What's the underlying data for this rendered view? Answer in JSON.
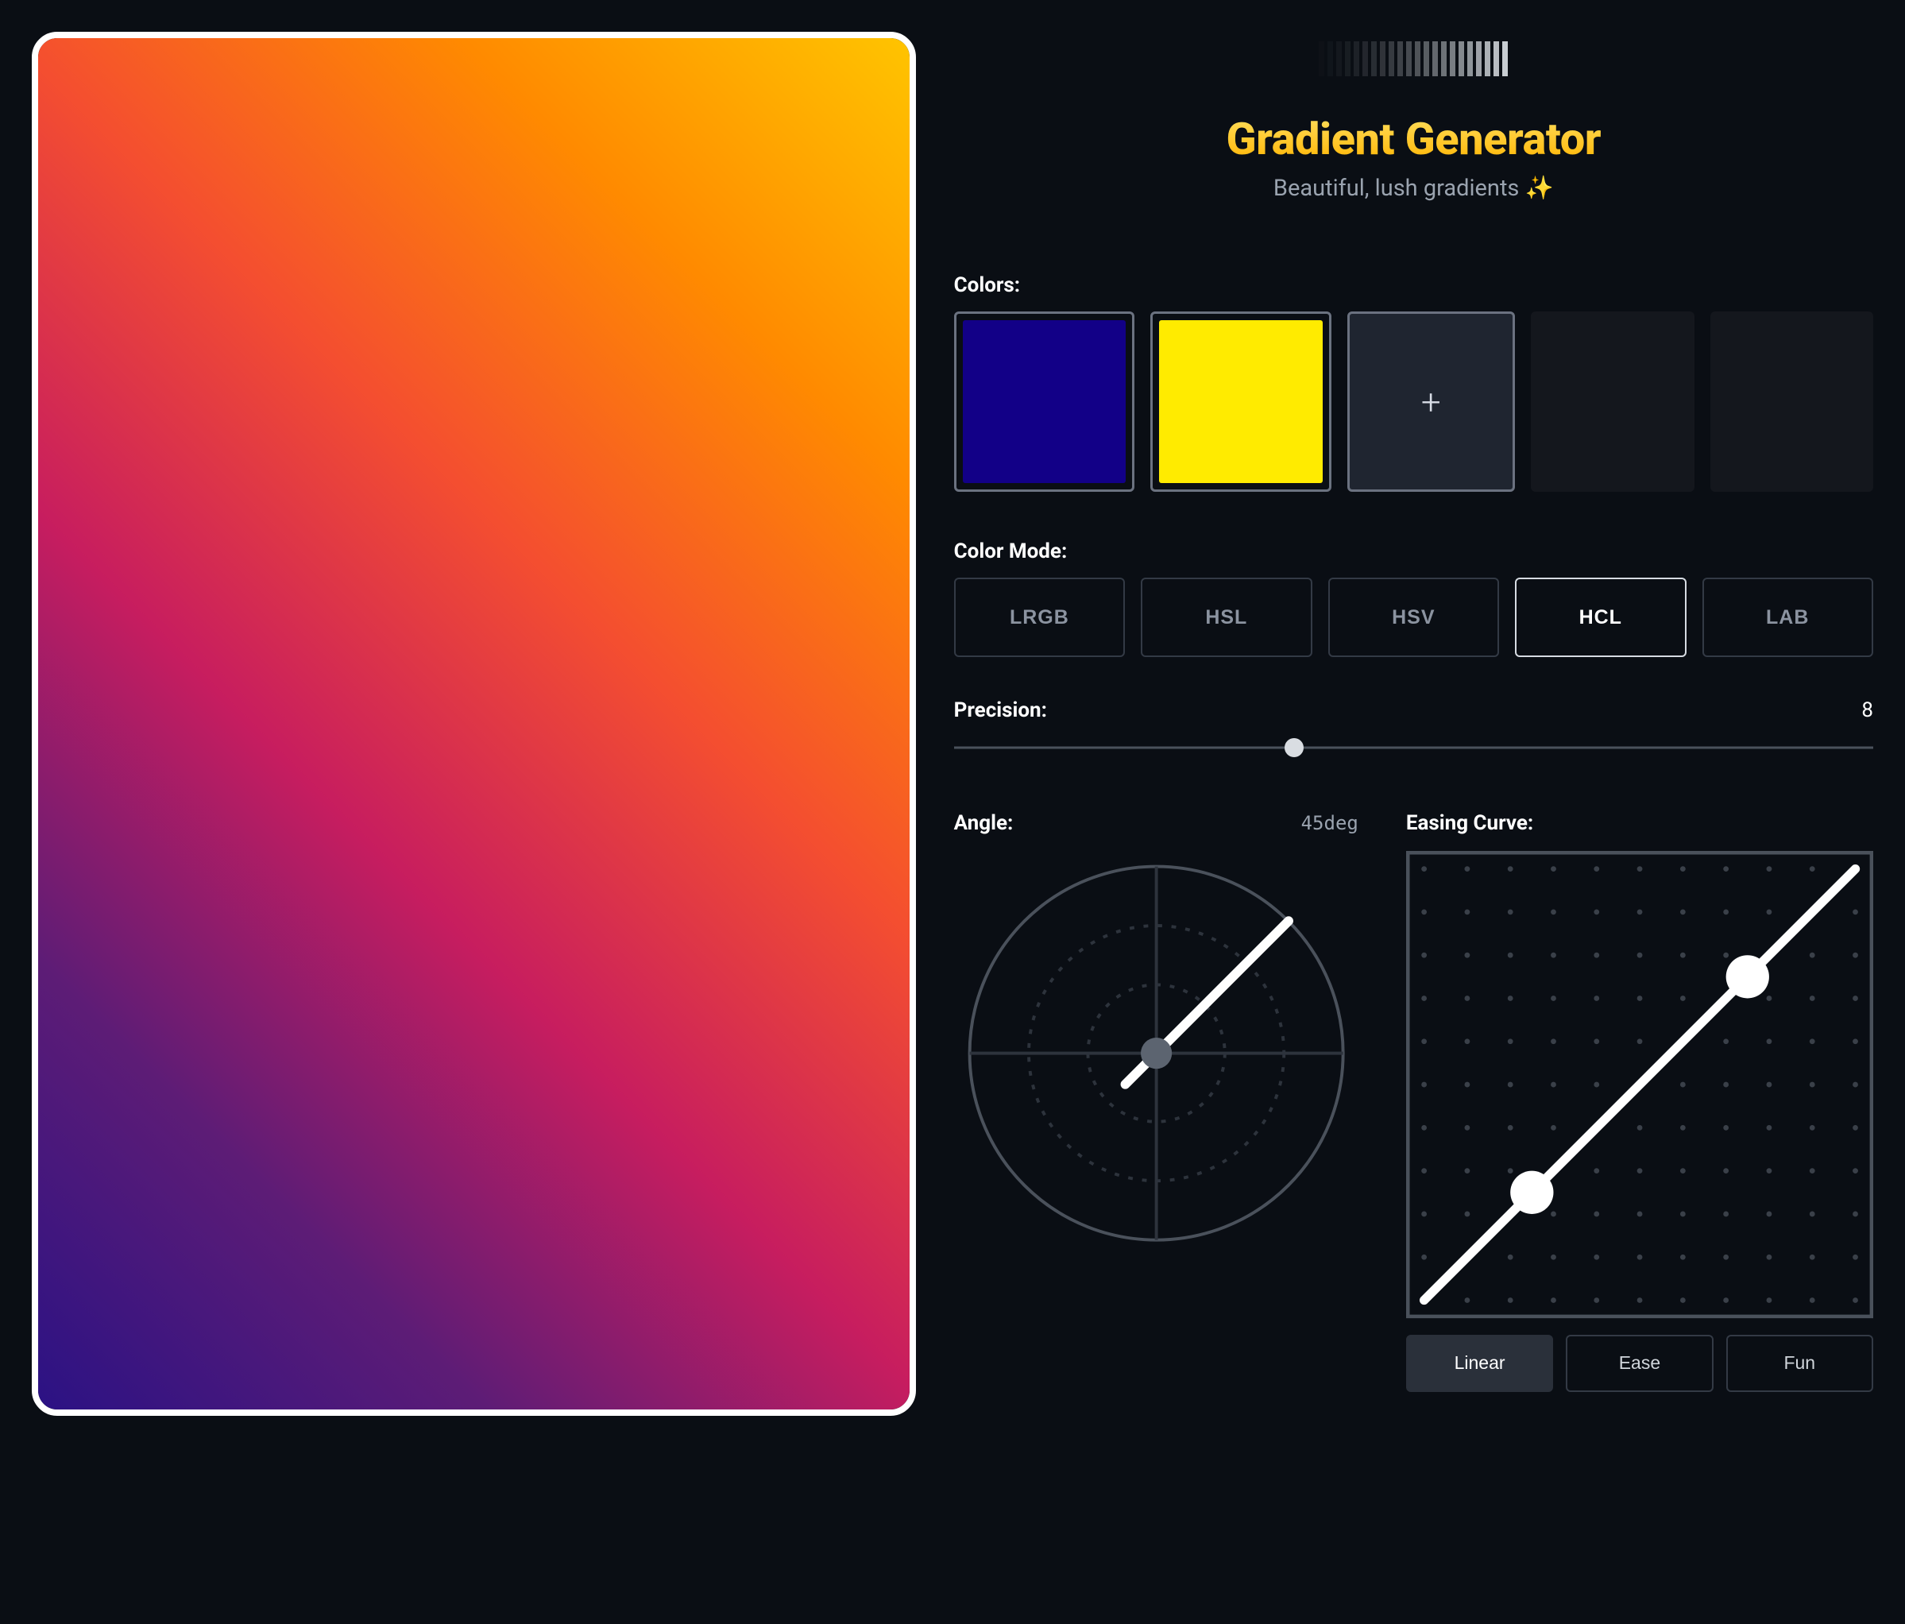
{
  "hero": {
    "title": "Gradient Generator",
    "subtitle": "Beautiful, lush gradients ✨"
  },
  "colors": {
    "label": "Colors:",
    "swatches": [
      {
        "hex": "#120087"
      },
      {
        "hex": "#ffeb00"
      }
    ],
    "add_label": "+"
  },
  "color_mode": {
    "label": "Color Mode:",
    "options": [
      "LRGB",
      "HSL",
      "HSV",
      "HCL",
      "LAB"
    ],
    "selected": "HCL"
  },
  "precision": {
    "label": "Precision:",
    "value": "8",
    "min": 1,
    "max": 20,
    "percent": 37
  },
  "angle": {
    "label": "Angle:",
    "value": "45deg",
    "degrees": 45
  },
  "easing": {
    "label": "Easing Curve:",
    "presets": [
      "Linear",
      "Ease",
      "Fun"
    ],
    "selected": "Linear",
    "p1": [
      0.25,
      0.25
    ],
    "p2": [
      0.75,
      0.75
    ]
  },
  "preview": {
    "gradient_css": "linear-gradient(45deg, #2b1284, #5d1c76, #c71d5f, #f44e30, #ff8a00, #ffc400)"
  }
}
